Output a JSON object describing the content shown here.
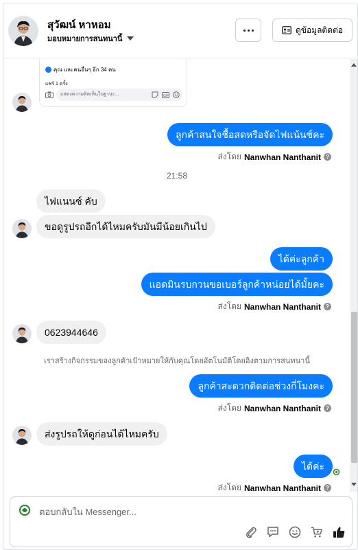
{
  "header": {
    "name": "สุวัฒน์ หาหอม",
    "assign_label": "มอบหมายการสนทนานี้",
    "contact_label": "ดูข้อมูลติดต่อ"
  },
  "post_card": {
    "likes_text": "คุณ และคนอื่นๆ อีก 34 คน",
    "shares_text": "แชร์ 1 ครั้ง",
    "comment_placeholder": "แสดงความคิดเห็นในฐานะ..."
  },
  "messages": [
    {
      "text": "ลูกค้าสนใจชื้อสดหรือจัดไฟแน้นซ์คะ"
    },
    {
      "text": "ไฟแนนซ์ คับ"
    },
    {
      "text": "ขอดูรูปรถอีกได้ไหมครับมันมีน้อยเกินไป"
    },
    {
      "text": "ได้ค่ะลูกค้า"
    },
    {
      "text": "แอดมินรบกวนขอเบอร์ลูกค้าหน่อยได้มั้ยคะ"
    },
    {
      "text": "0623944646"
    },
    {
      "text": "ลูกค้าสะดวกติดต่อช่วงกี่โมงคะ"
    },
    {
      "text": "ส่งรูปรถให้ดูก่อนได้ไหมครับ"
    },
    {
      "text": "ได้ค่ะ"
    }
  ],
  "sent_by_prefix": "ส่งโดย",
  "sent_by_name": "Nanwhan Nanthanit",
  "timestamp": "21:58",
  "system_note": "เราสร้างกิจกรรมของลูกค้าเป้าหมายให้กับคุณโดยอัตโนมัติโดยอิงตามการสนทนานี้",
  "composer": {
    "placeholder": "ตอบกลับใน Messenger..."
  },
  "colors": {
    "outgoing_bubble": "#0a7cff",
    "incoming_bubble": "#f0f0f0",
    "secondary_text": "#65676b"
  },
  "icons": [
    "more-icon",
    "contact-card-icon",
    "caret-down-icon",
    "help-icon",
    "camera-icon",
    "sticker-icon",
    "gif-icon",
    "emoji-icon",
    "attachment-icon",
    "saved-reply-icon",
    "emoji-icon",
    "cart-icon",
    "thumbs-up-icon"
  ]
}
